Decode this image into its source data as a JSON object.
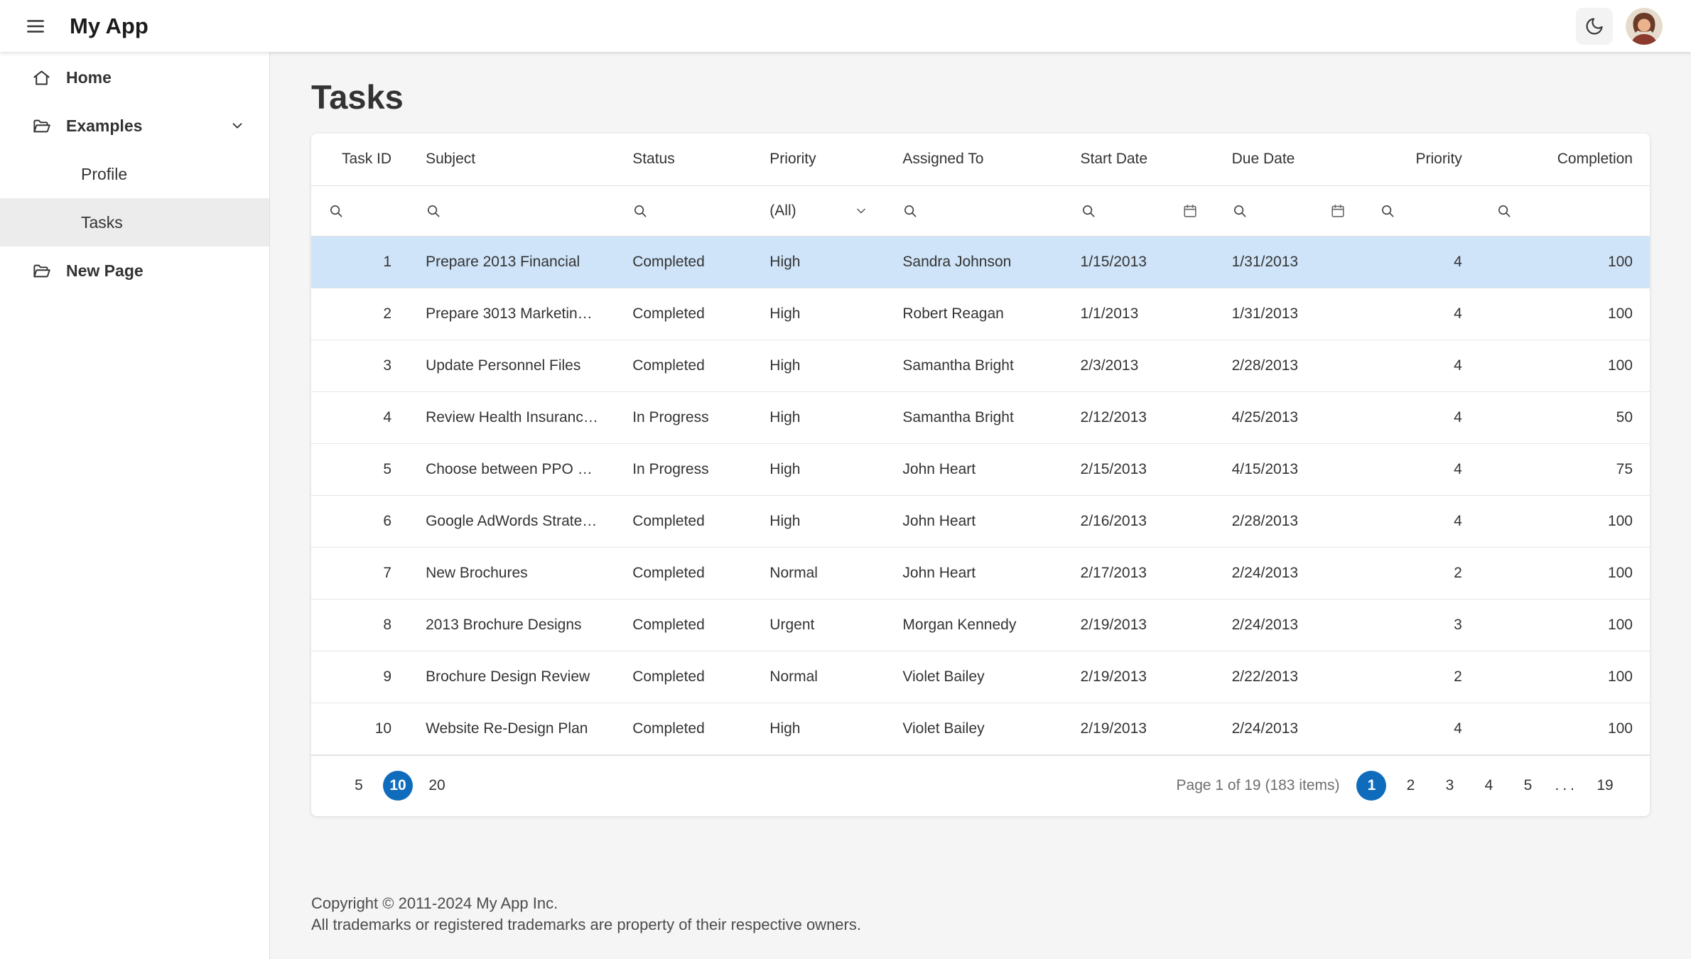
{
  "header": {
    "app_title": "My App"
  },
  "sidebar": {
    "items": [
      {
        "label": "Home"
      },
      {
        "label": "Examples"
      },
      {
        "label": "Profile"
      },
      {
        "label": "Tasks"
      },
      {
        "label": "New Page"
      }
    ]
  },
  "page": {
    "title": "Tasks"
  },
  "grid": {
    "columns": [
      {
        "label": "Task ID"
      },
      {
        "label": "Subject"
      },
      {
        "label": "Status"
      },
      {
        "label": "Priority"
      },
      {
        "label": "Assigned To"
      },
      {
        "label": "Start Date"
      },
      {
        "label": "Due Date"
      },
      {
        "label": "Priority"
      },
      {
        "label": "Completion"
      }
    ],
    "filter": {
      "priority_all": "(All)"
    },
    "selected_row_index": 0,
    "rows": [
      [
        "1",
        "Prepare 2013 Financial",
        "Completed",
        "High",
        "Sandra Johnson",
        "1/15/2013",
        "1/31/2013",
        "4",
        "100"
      ],
      [
        "2",
        "Prepare 3013 Marketin…",
        "Completed",
        "High",
        "Robert Reagan",
        "1/1/2013",
        "1/31/2013",
        "4",
        "100"
      ],
      [
        "3",
        "Update Personnel Files",
        "Completed",
        "High",
        "Samantha Bright",
        "2/3/2013",
        "2/28/2013",
        "4",
        "100"
      ],
      [
        "4",
        "Review Health Insuranc…",
        "In Progress",
        "High",
        "Samantha Bright",
        "2/12/2013",
        "4/25/2013",
        "4",
        "50"
      ],
      [
        "5",
        "Choose between PPO a…",
        "In Progress",
        "High",
        "John Heart",
        "2/15/2013",
        "4/15/2013",
        "4",
        "75"
      ],
      [
        "6",
        "Google AdWords Strate…",
        "Completed",
        "High",
        "John Heart",
        "2/16/2013",
        "2/28/2013",
        "4",
        "100"
      ],
      [
        "7",
        "New Brochures",
        "Completed",
        "Normal",
        "John Heart",
        "2/17/2013",
        "2/24/2013",
        "2",
        "100"
      ],
      [
        "8",
        "2013 Brochure Designs",
        "Completed",
        "Urgent",
        "Morgan Kennedy",
        "2/19/2013",
        "2/24/2013",
        "3",
        "100"
      ],
      [
        "9",
        "Brochure Design Review",
        "Completed",
        "Normal",
        "Violet Bailey",
        "2/19/2013",
        "2/22/2013",
        "2",
        "100"
      ],
      [
        "10",
        "Website Re-Design Plan",
        "Completed",
        "High",
        "Violet Bailey",
        "2/19/2013",
        "2/24/2013",
        "4",
        "100"
      ]
    ]
  },
  "pager": {
    "page_sizes": [
      "5",
      "10",
      "20"
    ],
    "selected_page_size": "10",
    "info": "Page 1 of 19 (183 items)",
    "pages": [
      "1",
      "2",
      "3",
      "4",
      "5",
      "...",
      "19"
    ],
    "current_page": "1"
  },
  "footer": {
    "line1": "Copyright © 2011-2024 My App Inc.",
    "line2": "All trademarks or registered trademarks are property of their respective owners."
  },
  "colors": {
    "accent": "#0f6cbd",
    "selected_row": "#cfe4f9"
  }
}
